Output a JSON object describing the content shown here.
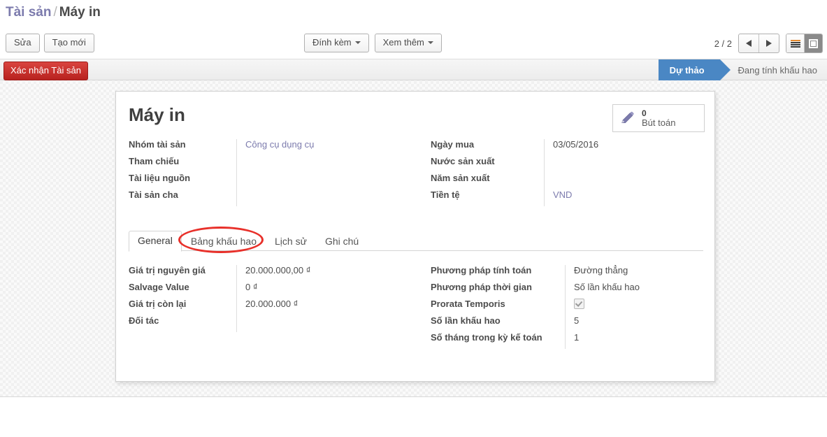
{
  "breadcrumb": {
    "parent": "Tài sản",
    "separator": "/",
    "current": "Máy in"
  },
  "toolbar": {
    "edit_label": "Sửa",
    "create_label": "Tạo mới",
    "attachment_label": "Đính kèm",
    "more_label": "Xem thêm",
    "pager_text": "2 / 2",
    "prev_icon": "arrow-left-icon",
    "next_icon": "arrow-right-icon",
    "list_view_icon": "list-view-icon",
    "form_view_icon": "form-view-icon"
  },
  "action_bar": {
    "confirm_label": "Xác nhận Tài sản",
    "confirm_color": "#b8221f"
  },
  "statusbar": {
    "active_color": "#4a87c4",
    "stages": [
      {
        "label": "Dự thảo",
        "active": true
      },
      {
        "label": "Đang tính khấu hao",
        "active": false
      }
    ]
  },
  "record": {
    "title": "Máy in",
    "stat_button": {
      "icon": "pencil-icon",
      "value": "0",
      "label": "Bút toán"
    },
    "header_fields_left": [
      {
        "label": "Nhóm tài sản",
        "value": "Công cụ dụng cụ",
        "is_link": true
      },
      {
        "label": "Tham chiếu",
        "value": "",
        "is_link": false
      },
      {
        "label": "Tài liệu nguồn",
        "value": "",
        "is_link": false
      },
      {
        "label": "Tài sản cha",
        "value": "",
        "is_link": false
      }
    ],
    "header_fields_right": [
      {
        "label": "Ngày mua",
        "value": "03/05/2016",
        "is_link": false
      },
      {
        "label": "Nước sản xuất",
        "value": "",
        "is_link": false
      },
      {
        "label": "Năm sản xuất",
        "value": "",
        "is_link": false
      },
      {
        "label": "Tiền tệ",
        "value": "VND",
        "is_link": true
      }
    ]
  },
  "notebook": {
    "tabs": [
      {
        "label": "General",
        "active": true
      },
      {
        "label": "Bảng khấu hao",
        "active": false
      },
      {
        "label": "Lịch sử",
        "active": false
      },
      {
        "label": "Ghi chú",
        "active": false
      }
    ]
  },
  "general_tab": {
    "left_fields": [
      {
        "label": "Giá trị nguyên giá",
        "value": "20.000.000,00 ₫",
        "type": "text"
      },
      {
        "label": "Salvage Value",
        "value": "0 ₫",
        "type": "text"
      },
      {
        "label": "Giá trị còn lại",
        "value": "20.000.000 ₫",
        "type": "text"
      },
      {
        "label": "Đối tác",
        "value": "",
        "type": "text"
      }
    ],
    "right_fields": [
      {
        "label": "Phương pháp tính toán",
        "value": "Đường thẳng",
        "type": "text"
      },
      {
        "label": "Phương pháp thời gian",
        "value": "Số lần khấu hao",
        "type": "text"
      },
      {
        "label": "Prorata Temporis",
        "value": "",
        "type": "checkbox",
        "checked": true
      },
      {
        "label": "Số lần khấu hao",
        "value": "5",
        "type": "text"
      },
      {
        "label": "Số tháng trong kỳ kế toán",
        "value": "1",
        "type": "text"
      }
    ]
  },
  "annotation": {
    "shape": "ellipse",
    "color": "#e8302a",
    "target": "Bảng khấu hao"
  }
}
